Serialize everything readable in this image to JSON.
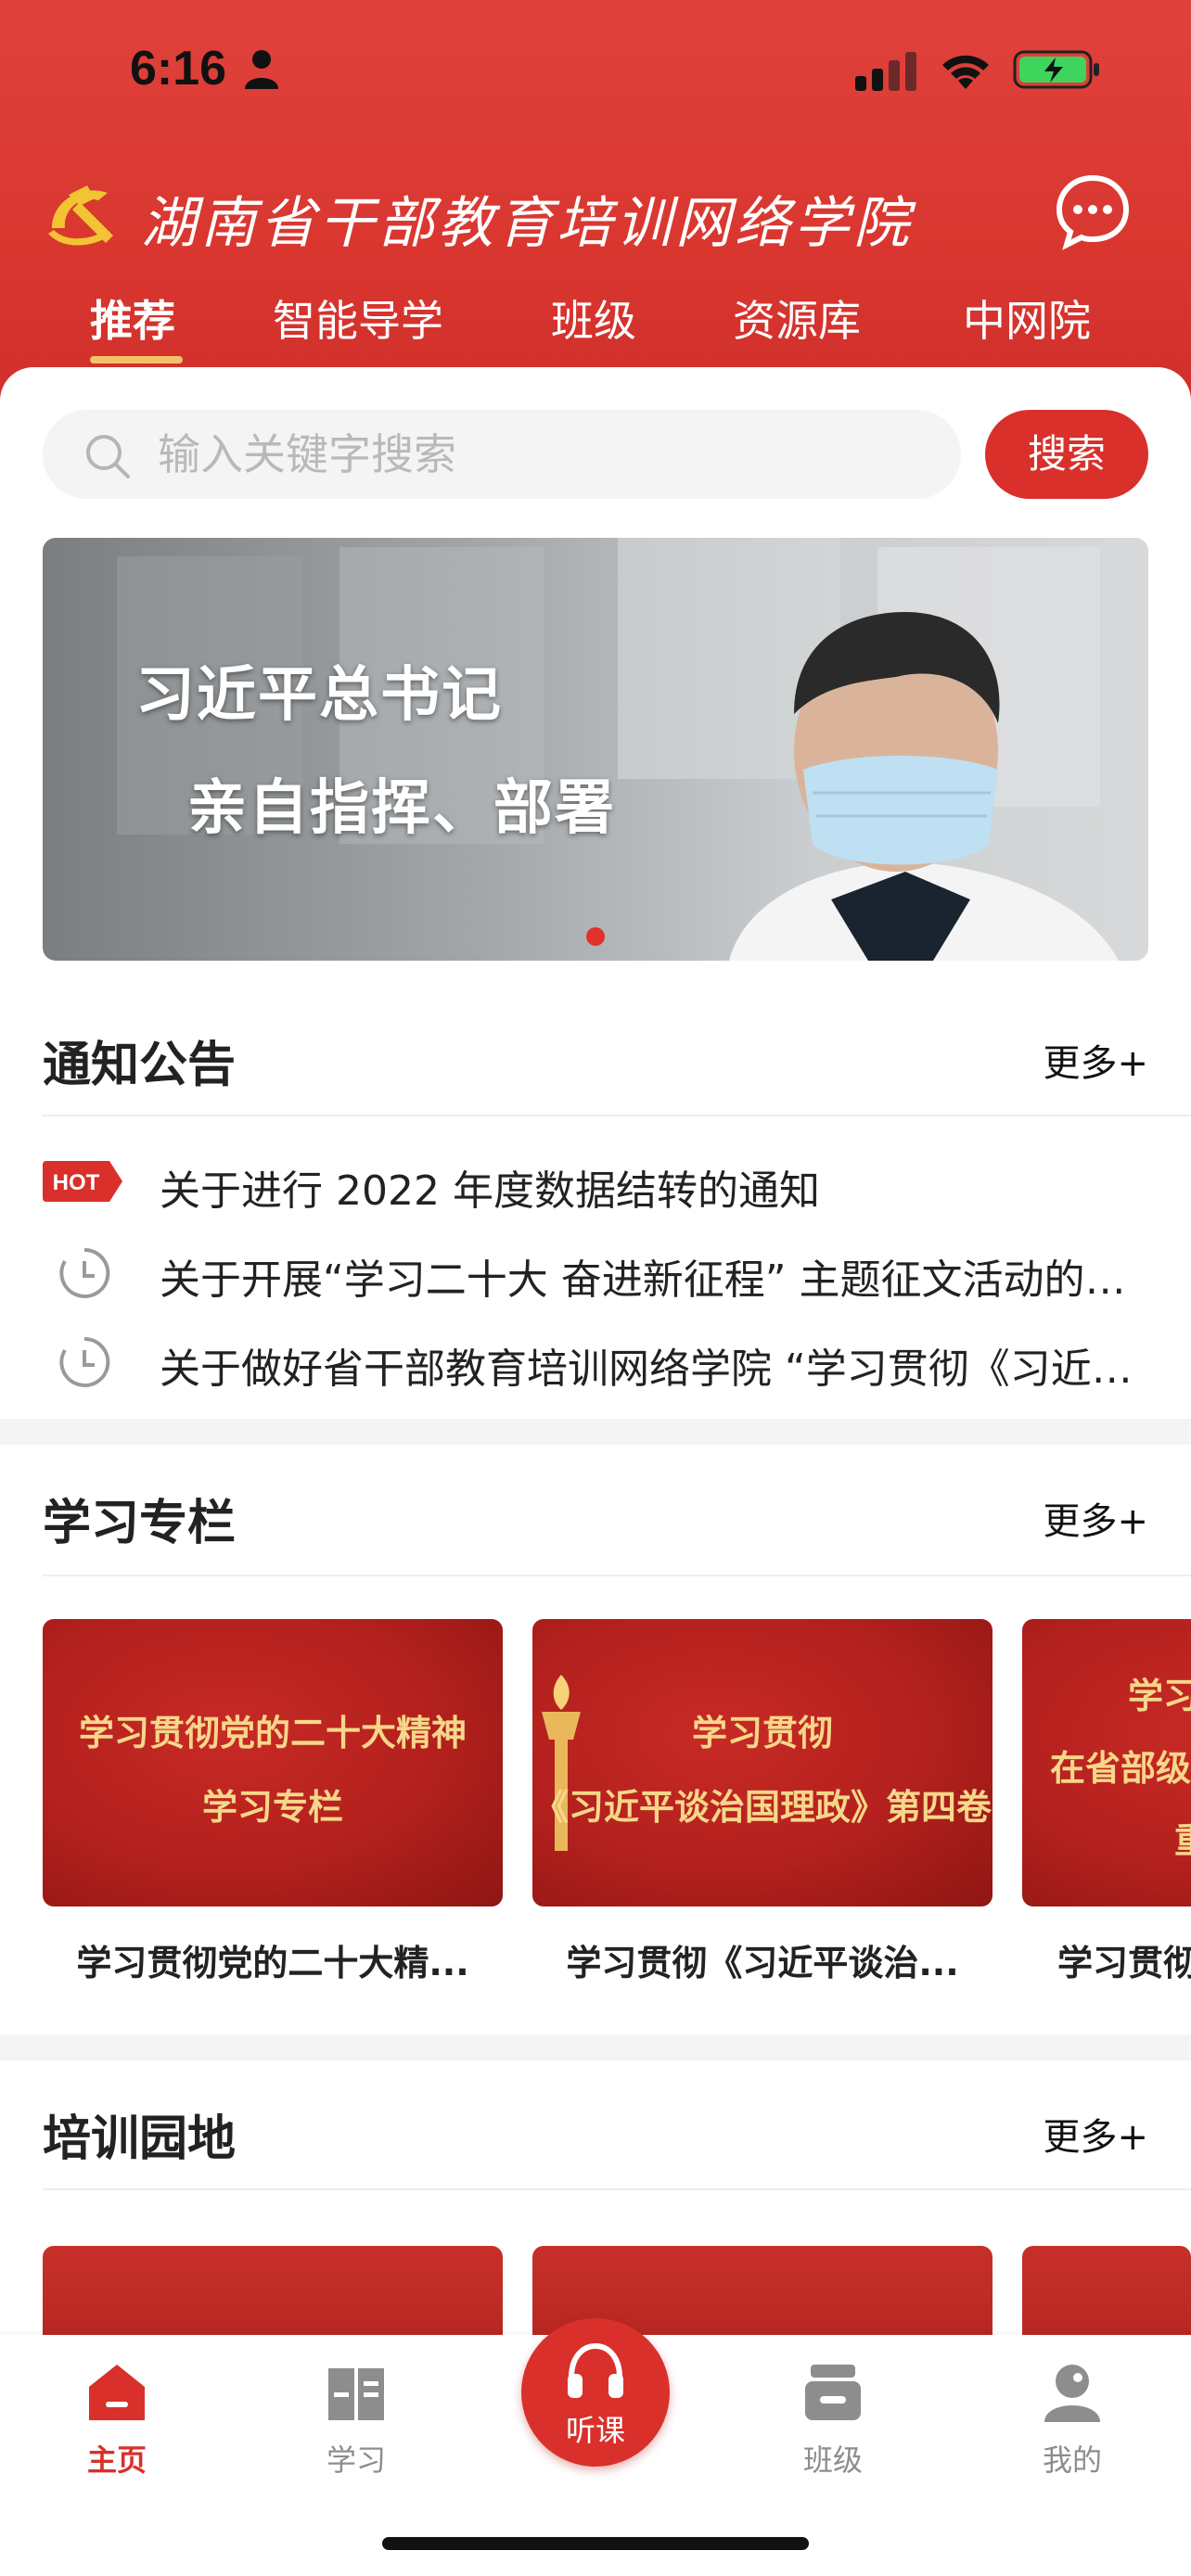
{
  "status_bar": {
    "time": "6:16"
  },
  "header": {
    "brand_title": "湖南省干部教育培训网络学院",
    "tabs": [
      {
        "label": "推荐",
        "active": true
      },
      {
        "label": "智能导学",
        "active": false
      },
      {
        "label": "班级",
        "active": false
      },
      {
        "label": "资源库",
        "active": false
      },
      {
        "label": "中网院",
        "active": false
      }
    ]
  },
  "search": {
    "placeholder": "输入关键字搜索",
    "button_label": "搜索"
  },
  "banner": {
    "line1": "习近平总书记",
    "line2": "亲自指挥、部署",
    "page_count": 1,
    "active_page": 1
  },
  "notices": {
    "title": "通知公告",
    "more_label": "更多+",
    "hot_badge": "HOT",
    "items": [
      {
        "text": "关于进行 2022 年度数据结转的通知",
        "icon": "hot-badge"
      },
      {
        "text": "关于开展“学习二十大  奋进新征程” 主题征文活动的通知",
        "icon": "clock-icon"
      },
      {
        "text": "关于做好省干部教育培训网络学院 “学习贯彻《习近平谈治国理政》第四卷”",
        "icon": "clock-icon"
      }
    ]
  },
  "study_column": {
    "title": "学习专栏",
    "more_label": "更多+",
    "cards": [
      {
        "cover_lines": [
          "学习贯彻党的二十大精神",
          "学习专栏"
        ],
        "caption": "学习贯彻党的二十大精..."
      },
      {
        "cover_lines": [
          "学习贯彻",
          "《习近平谈治国理政》第四卷"
        ],
        "caption": "学习贯彻《习近平谈治..."
      },
      {
        "cover_lines": [
          "学习贯",
          "在省部级主要",
          "重"
        ],
        "caption": "学习贯彻"
      }
    ]
  },
  "training": {
    "title": "培训园地",
    "more_label": "更多+"
  },
  "bottom_nav": {
    "items": [
      {
        "label": "主页",
        "icon": "home-icon",
        "active": true
      },
      {
        "label": "学习",
        "icon": "book-icon",
        "active": false
      },
      {
        "label": "听课",
        "icon": "headphones-icon",
        "active": false
      },
      {
        "label": "班级",
        "icon": "class-icon",
        "active": false
      },
      {
        "label": "我的",
        "icon": "profile-icon",
        "active": false
      }
    ]
  },
  "colors": {
    "brand_red": "#d9302b",
    "tab_underline": "#f3c26a",
    "gold_text": "#f6d78a"
  }
}
